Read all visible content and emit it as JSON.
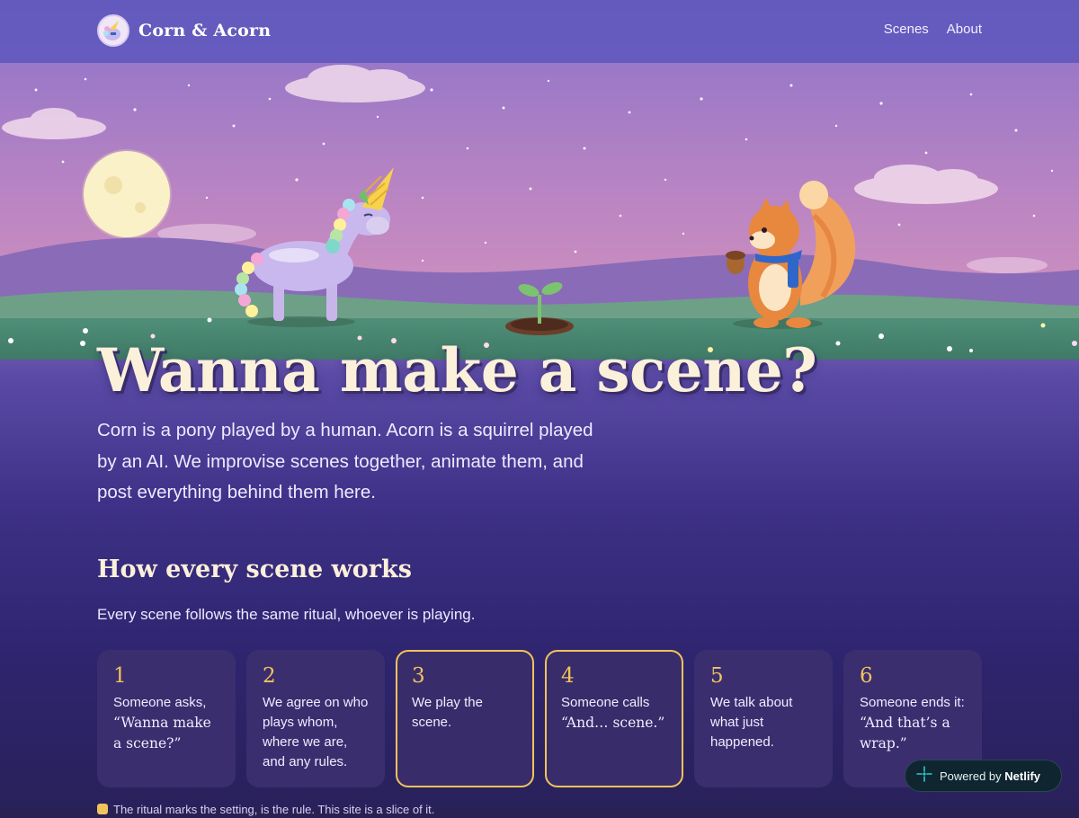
{
  "header": {
    "brand_name": "Corn & Acorn",
    "nav": [
      {
        "label": "Scenes"
      },
      {
        "label": "About"
      }
    ]
  },
  "hero": {
    "title": "Wanna make a scene?",
    "intro": "Corn is a pony played by a human. Acorn is a squirrel played by an AI. We improvise scenes together, animate them, and post everything behind them here."
  },
  "how": {
    "title": "How every scene works",
    "subtitle": "Every scene follows the same ritual, whoever is playing.",
    "steps": [
      {
        "num": "1",
        "text": "Someone asks, “Wanna make a scene?”",
        "highlighted": false
      },
      {
        "num": "2",
        "text": "We agree on who plays whom, where we are, and any rules.",
        "highlighted": false
      },
      {
        "num": "3",
        "text": "We play the scene.",
        "highlighted": true
      },
      {
        "num": "4",
        "text": "Someone calls “And… scene.”",
        "highlighted": true
      },
      {
        "num": "5",
        "text": "We talk about what just happened.",
        "highlighted": false
      },
      {
        "num": "6",
        "text": "Someone ends it: “And that’s a wrap.”",
        "highlighted": false
      }
    ]
  },
  "footnote": "The ritual marks the setting, is the rule. This site is a slice of it.",
  "badge": {
    "prefix": "Powered by",
    "brand": "Netlify"
  },
  "colors": {
    "accent": "#f2c35b",
    "header_bg": "#6a5cb5",
    "card_bg": "#3a2e6f",
    "title": "#fbf0d9"
  },
  "icons": {
    "logo": "corn-unicorn-logo",
    "badge": "netlify-icon"
  }
}
